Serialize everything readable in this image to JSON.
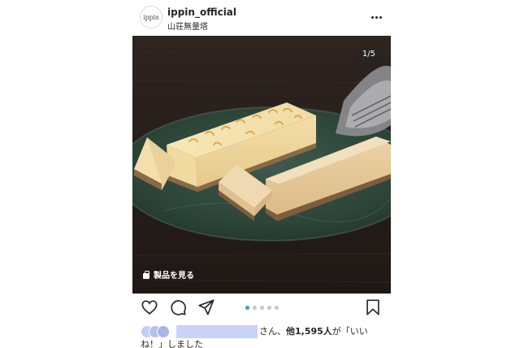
{
  "header": {
    "avatar_text": "ippin",
    "username": "ippin_official",
    "location": "山荘無量塔"
  },
  "photo": {
    "counter": "1/5",
    "shop_label": "製品を見る"
  },
  "actions": {
    "icons": [
      "heart-icon",
      "comment-icon",
      "share-icon",
      "bookmark-icon"
    ],
    "carousel_dots": 5,
    "active_dot": 1,
    "accent_color": "#3897f0"
  },
  "likes": {
    "prefix": "さん、",
    "count_text": "他1,595人",
    "suffix": "が「いい",
    "line2": "ね！」しました"
  }
}
